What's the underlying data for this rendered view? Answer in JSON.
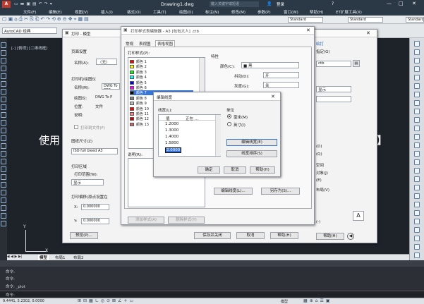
{
  "app": {
    "title": "Drawing1.dwg",
    "search_placeholder": "键入关键字或短语",
    "login": "登录",
    "workspace": "AutoCAD 经典"
  },
  "menu": [
    "文件(F)",
    "编辑(E)",
    "视图(V)",
    "插入(I)",
    "格式(O)",
    "工具(T)",
    "绘图(D)",
    "标注(N)",
    "修改(M)",
    "参数(P)",
    "窗口(W)",
    "帮助(H)",
    "ET扩展工具(X)"
  ],
  "toolbar2": {
    "style1": "Standard",
    "style2": "Standard",
    "style3": "Standard"
  },
  "viewport_label": "[-] [俯视] [二维线框]",
  "background_text": {
    "left": "使用",
    "right": "】"
  },
  "layout_tabs": [
    "模型",
    "布局1",
    "布局2"
  ],
  "command": {
    "line1": "命令:",
    "line2": "命令:",
    "line3": "命令: _plot",
    "prompt": "命令:"
  },
  "status_coords": "9.4441, 5.2302, 0.0000",
  "status_model": "模型",
  "plot_dialog": {
    "title": "打印 - 模型",
    "page_setup": "页面设置",
    "name_label": "名称(A):",
    "name_value": "〈无〉",
    "printer_section": "打印机/绘图仪",
    "printer_name_label": "名称(M):",
    "printer_name_value": "DWG To PDF",
    "plotter_label": "绘图仪:",
    "plotter_value": "DWG To P",
    "where_label": "位置:",
    "where_value": "文件",
    "desc_label": "说明:",
    "plot_to_file": "打印到文件(F)",
    "paper_size_label": "图纸尺寸(Z)",
    "paper_size_value": "ISO full bleed A3",
    "plot_area_label": "打印区域",
    "what_to_plot_label": "打印范围(W):",
    "what_to_plot_value": "显示",
    "offset_label": "打印偏移(原点设置在",
    "x_label": "X:",
    "x_value": "0.000000",
    "y_label": "Y:",
    "y_value": "0.000000",
    "preview_button": "预览(P)...",
    "apply_button": "应用到布局(U)",
    "ok_button": "确定",
    "cancel_button": "取消",
    "help_button": "帮助(H)"
  },
  "pse_dialog": {
    "title": "打印样式表编辑器 - A3 [包包大人] .ctb",
    "tabs": [
      "常规",
      "表视图",
      "表格视图"
    ],
    "styles_label": "打印样式(P):",
    "styles": [
      {
        "name": "颜色 1",
        "color": "#ff0000"
      },
      {
        "name": "颜色 2",
        "color": "#ffff00"
      },
      {
        "name": "颜色 3",
        "color": "#00ff00"
      },
      {
        "name": "颜色 4",
        "color": "#00ffff"
      },
      {
        "name": "颜色 5",
        "color": "#0000ff"
      },
      {
        "name": "颜色 6",
        "color": "#ff00ff"
      },
      {
        "name": "颜色 7",
        "color": "#000000"
      },
      {
        "name": "颜色 8",
        "color": "#808080"
      },
      {
        "name": "颜色 9",
        "color": "#c0c0c0"
      },
      {
        "name": "颜色 10",
        "color": "#ff0000"
      },
      {
        "name": "颜色 11",
        "color": "#ff7f7f"
      },
      {
        "name": "颜色 12",
        "color": "#cc0000"
      },
      {
        "name": "颜色 13",
        "color": "#cc6666"
      }
    ],
    "desc_label": "说明(R):",
    "props_label": "特性",
    "color_label": "颜色(C):",
    "color_value": "■ 黑",
    "dither_label": "抖动(D):",
    "dither_value": "开",
    "gray_label": "灰度(G):",
    "gray_value": "关",
    "add_style": "添加样式(A)",
    "delete_style": "删除样式(Y)",
    "edit_lineweights": "编辑线宽(L)...",
    "save_as": "另存为(S)...",
    "save_close": "保存并关闭",
    "cancel": "取消",
    "help": "帮助(H)"
  },
  "lw_dialog": {
    "title": "编辑线宽",
    "lineweights_label": "线宽(L):",
    "col_value": "值",
    "col_inuse": "正在 ...",
    "values": [
      "1.2000",
      "1.3000",
      "1.4000",
      "1.5800",
      "2.0000"
    ],
    "selected_value": "2.0000",
    "units_label": "单位",
    "unit_mm": "毫米(M)",
    "unit_in": "英寸(I)",
    "edit_button": "编辑线宽(E)",
    "sort_button": "线宽排序(S)",
    "ok": "确定",
    "cancel": "取消",
    "help": "帮助(H)"
  },
  "right_panel": {
    "link": "绘打",
    "setting": "指定(G)",
    "ctb": "ctb",
    "display": "显示",
    "options": [
      "(D)",
      "(Q)",
      "空间",
      "对象(J)",
      "(E)",
      "布局(V)"
    ],
    "help": "帮助(H)",
    "dash": "(-)"
  }
}
